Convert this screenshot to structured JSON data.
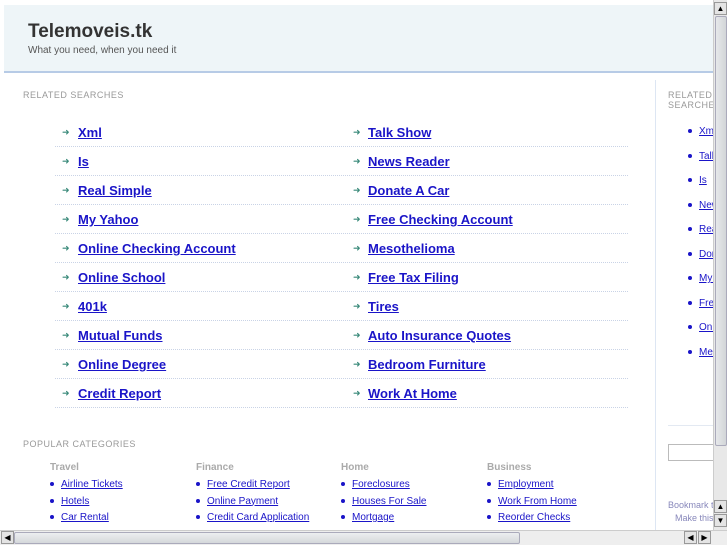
{
  "header": {
    "title": "Telemoveis.tk",
    "tagline": "What you need, when you need it"
  },
  "related": {
    "heading": "RELATED SEARCHES",
    "left": [
      "Xml",
      "Is",
      "Real Simple",
      "My Yahoo",
      "Online Checking Account",
      "Online School",
      "401k",
      "Mutual Funds",
      "Online Degree",
      "Credit Report"
    ],
    "right": [
      "Talk Show",
      "News Reader",
      "Donate A Car",
      "Free Checking Account",
      "Mesothelioma",
      "Free Tax Filing",
      "Tires",
      "Auto Insurance Quotes",
      "Bedroom Furniture",
      "Work At Home"
    ]
  },
  "popular": {
    "heading": "POPULAR CATEGORIES",
    "columns": [
      {
        "title": "Travel",
        "items": [
          "Airline Tickets",
          "Hotels",
          "Car Rental"
        ]
      },
      {
        "title": "Finance",
        "items": [
          "Free Credit Report",
          "Online Payment",
          "Credit Card Application"
        ]
      },
      {
        "title": "Home",
        "items": [
          "Foreclosures",
          "Houses For Sale",
          "Mortgage"
        ]
      },
      {
        "title": "Business",
        "items": [
          "Employment",
          "Work From Home",
          "Reorder Checks"
        ]
      }
    ]
  },
  "sidebar": {
    "heading": "RELATED SEARCHES",
    "items": [
      "Xml",
      "Talk Show",
      "Is",
      "News Reader",
      "Real Simple",
      "Donate A Car",
      "My Yahoo",
      "Free Checking Account",
      "Online Checking Account",
      "Mesothelioma"
    ],
    "bookmark": "Bookmark this page",
    "make_home": "Make this your homepage"
  },
  "icons": {
    "search_bullet": "arrow-right",
    "category_bullet": "disc"
  }
}
